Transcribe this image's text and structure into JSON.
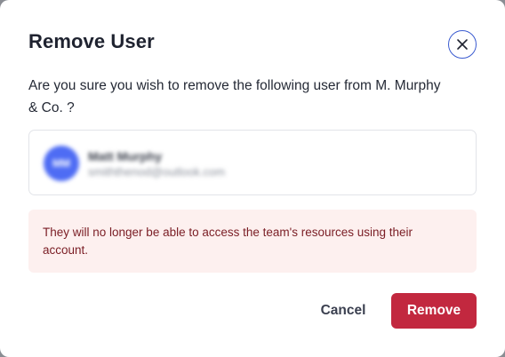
{
  "dialog": {
    "title": "Remove User",
    "prompt": "Are you sure you wish to remove the following user from M. Murphy & Co. ?",
    "close_icon": "close-icon"
  },
  "user": {
    "avatar_initials": "MM",
    "name": "Matt Murphy",
    "email": "smiththenod@outlook.com"
  },
  "warning": {
    "text": "They will no longer be able to access the team's resources using their account."
  },
  "actions": {
    "cancel_label": "Cancel",
    "remove_label": "Remove"
  },
  "colors": {
    "primary_danger": "#c2283f",
    "close_ring": "#3a5bd0",
    "avatar_bg": "#4e6cf4",
    "warning_bg": "#fdf0ef",
    "warning_text": "#7a1d24"
  }
}
